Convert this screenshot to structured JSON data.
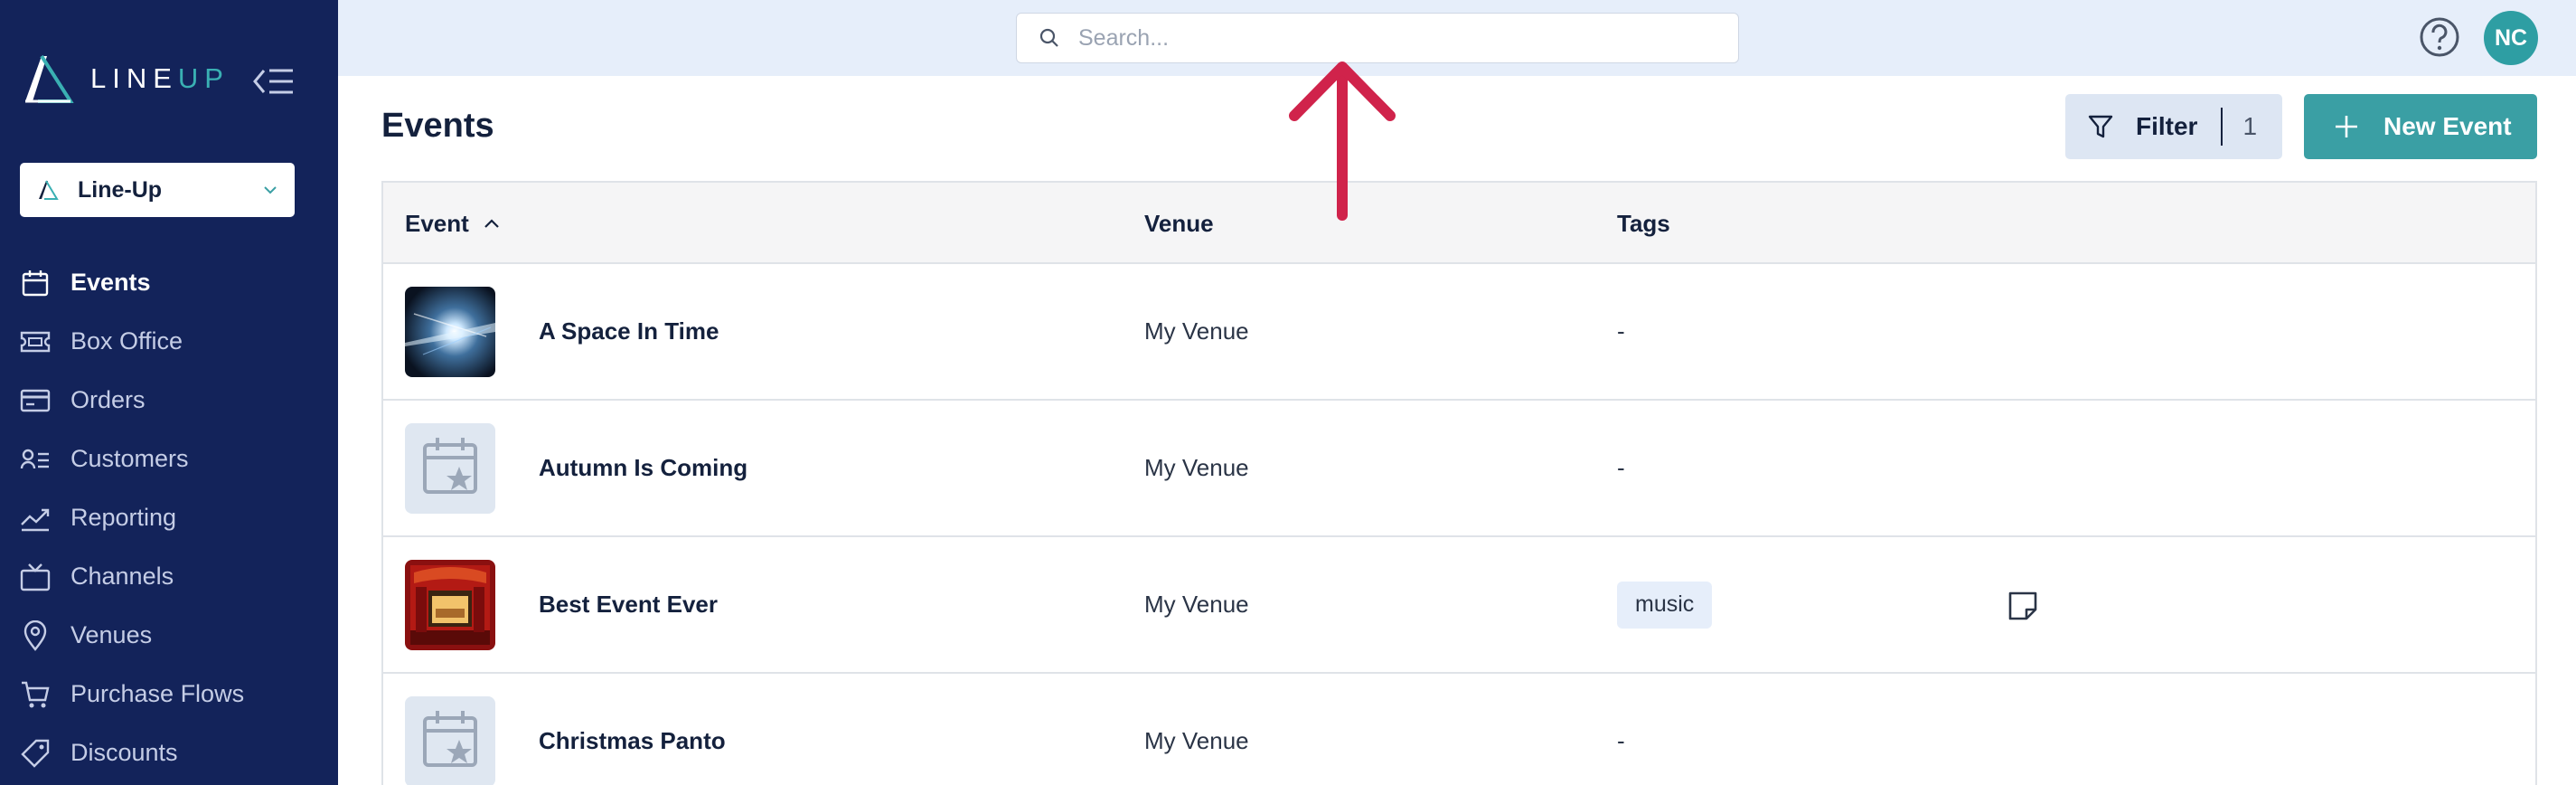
{
  "brand": {
    "logo_left": "LINE",
    "logo_right": "UP",
    "accent": "#3ab0b3",
    "sidebar_bg": "#13235a"
  },
  "org_selector": {
    "value": "Line-Up"
  },
  "sidebar": {
    "items": [
      {
        "label": "Events",
        "icon": "calendar-icon",
        "active": true
      },
      {
        "label": "Box Office",
        "icon": "ticket-icon"
      },
      {
        "label": "Orders",
        "icon": "card-icon"
      },
      {
        "label": "Customers",
        "icon": "customers-icon"
      },
      {
        "label": "Reporting",
        "icon": "chart-icon"
      },
      {
        "label": "Channels",
        "icon": "tv-icon"
      },
      {
        "label": "Venues",
        "icon": "location-pin-icon"
      },
      {
        "label": "Purchase Flows",
        "icon": "cart-icon"
      },
      {
        "label": "Discounts",
        "icon": "tag-icon"
      }
    ]
  },
  "topbar": {
    "search_placeholder": "Search...",
    "avatar_initials": "NC"
  },
  "main": {
    "title": "Events",
    "filter_label": "Filter",
    "filter_count": "1",
    "new_button_label": "New Event"
  },
  "table": {
    "columns": [
      "Event",
      "Venue",
      "Tags"
    ],
    "rows": [
      {
        "name": "A Space In Time",
        "venue": "My Venue",
        "tags": "-",
        "thumb": "space-image"
      },
      {
        "name": "Autumn Is Coming",
        "venue": "My Venue",
        "tags": "-",
        "thumb": "placeholder"
      },
      {
        "name": "Best Event Ever",
        "venue": "My Venue",
        "tags": "music",
        "thumb": "theatre-image",
        "has_note": true
      },
      {
        "name": "Christmas Panto",
        "venue": "My Venue",
        "tags": "-",
        "thumb": "placeholder"
      }
    ]
  },
  "annotation": {
    "arrow_color": "#d0234b",
    "pointing_to": "search-input"
  }
}
